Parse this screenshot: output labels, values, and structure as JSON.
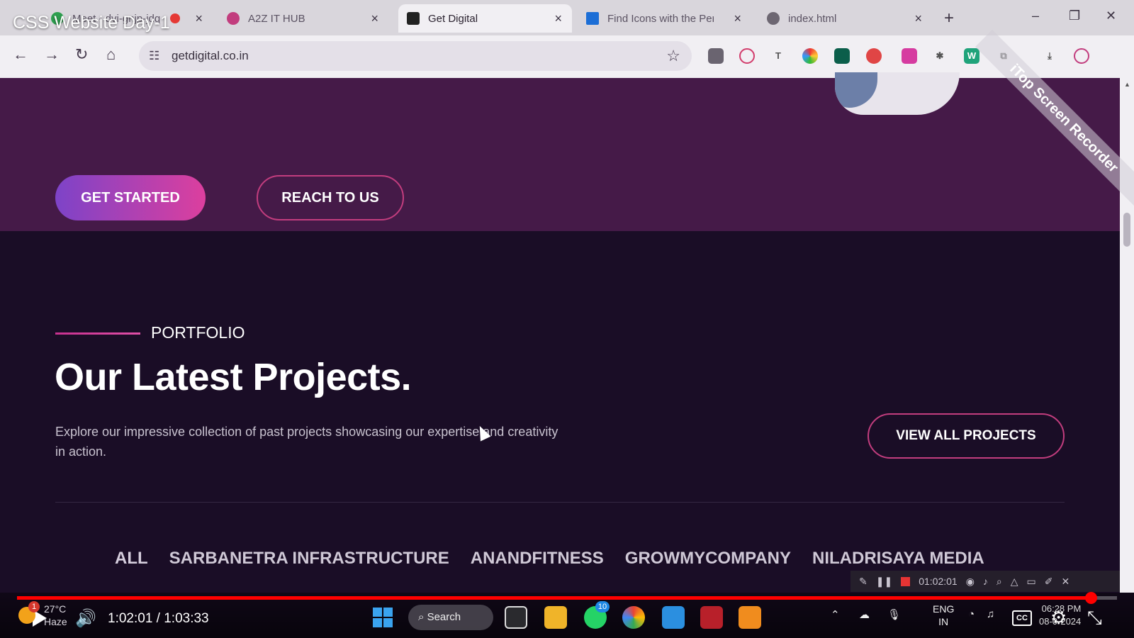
{
  "video": {
    "title": "CSS Website Day-1",
    "current_time": "1:02:01",
    "duration": "1:03:33",
    "time_display": "1:02:01 / 1:03:33",
    "progress": 0.976
  },
  "browser": {
    "tabs": [
      {
        "label": "Meet - dvi-gnjp-jdq",
        "favicon": "google-meet-icon",
        "active": false
      },
      {
        "label": "A2Z IT HUB",
        "favicon": "a2z-logo-icon",
        "active": false
      },
      {
        "label": "Get Digital",
        "favicon": "get-digital-logo-icon",
        "active": true
      },
      {
        "label": "Find Icons with the Perfe",
        "favicon": "font-awesome-flag-icon",
        "active": false
      },
      {
        "label": "index.html",
        "favicon": "globe-icon",
        "active": false
      }
    ],
    "url": "getdigital.co.in"
  },
  "hero": {
    "get_started_label": "GET STARTED",
    "reach_label": "REACH TO US"
  },
  "portfolio": {
    "eyebrow": "PORTFOLIO",
    "heading": "Our Latest Projects.",
    "description": "Explore our impressive collection of past projects showcasing our expertise and creativity in action.",
    "view_all_label": "VIEW ALL PROJECTS",
    "filters": [
      "ALL",
      "SARBANETRA INFRASTRUCTURE",
      "ANANDFITNESS",
      "GROWMYCOMPANY",
      "NILADRISAYA MEDIA"
    ]
  },
  "recorder": {
    "banner": "iTop Screen Recorder",
    "elapsed": "01:02:01"
  },
  "taskbar": {
    "weather_temp": "27°C",
    "weather_desc": "Haze",
    "weather_badge": "1",
    "search_label": "Search",
    "whatsapp_badge": "10",
    "lang_top": "ENG",
    "lang_bottom": "IN",
    "time": "06:28 PM",
    "date": "08-0-2024"
  },
  "colors": {
    "hero_bg": "#451a48",
    "section_bg": "#1a0d26",
    "accent_pink": "#c23d7e",
    "gradient_start": "#7d43c8",
    "gradient_end": "#dc3f9e"
  }
}
